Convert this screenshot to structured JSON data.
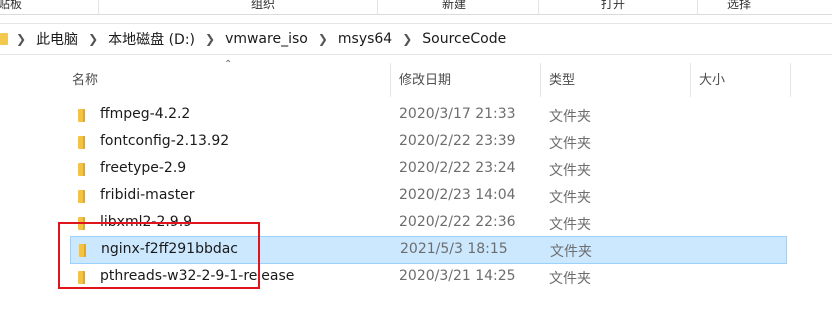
{
  "ribbon": {
    "groups": [
      "贴板",
      "组织",
      "新建",
      "打开",
      "选择"
    ],
    "accent_color": "#dadbdc"
  },
  "address_bar": {
    "breadcrumbs": [
      "此电脑",
      "本地磁盘 (D:)",
      "vmware_iso",
      "msys64",
      "SourceCode"
    ],
    "separator_icon": "chevron-right-icon"
  },
  "columns": {
    "name": "名称",
    "date_modified": "修改日期",
    "type": "类型",
    "size": "大小",
    "sort_icon": "sort-ascending-icon"
  },
  "files": [
    {
      "name": "ffmpeg-4.2.2",
      "date": "2020/3/17 21:33",
      "type": "文件夹",
      "selected": false
    },
    {
      "name": "fontconfig-2.13.92",
      "date": "2020/2/22 23:39",
      "type": "文件夹",
      "selected": false
    },
    {
      "name": "freetype-2.9",
      "date": "2020/2/22 23:24",
      "type": "文件夹",
      "selected": false
    },
    {
      "name": "fribidi-master",
      "date": "2020/2/23 14:04",
      "type": "文件夹",
      "selected": false
    },
    {
      "name": "libxml2-2.9.9",
      "date": "2020/2/22 22:36",
      "type": "文件夹",
      "selected": false
    },
    {
      "name": "nginx-f2ff291bbdac",
      "date": "2021/5/3 18:15",
      "type": "文件夹",
      "selected": true
    },
    {
      "name": "pthreads-w32-2-9-1-release",
      "date": "2020/3/21 14:25",
      "type": "文件夹",
      "selected": false
    }
  ],
  "colors": {
    "selection_bg": "#cce8ff",
    "selection_border": "#99d1ff",
    "folder": "#f5c343",
    "annotation_box": "#e0151c"
  }
}
